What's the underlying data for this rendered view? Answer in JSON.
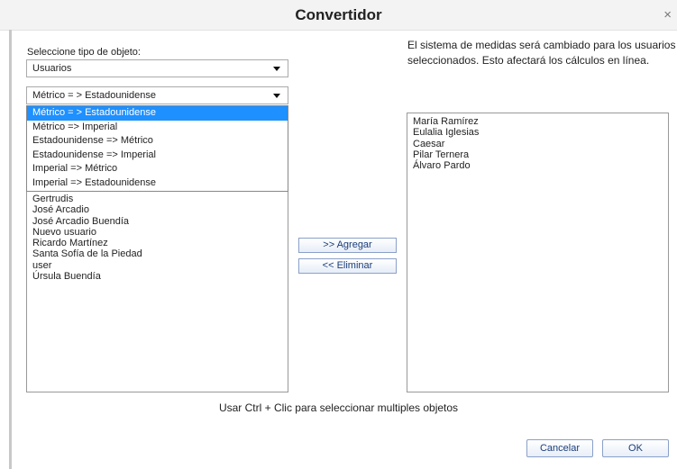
{
  "window": {
    "title": "Convertidor",
    "close_glyph": "×"
  },
  "left": {
    "object_type_label": "Seleccione tipo de objeto:",
    "object_type_value": "Usuarios",
    "conversion_value": "Métrico = > Estadounidense",
    "conversion_options": [
      "Métrico = > Estadounidense",
      "Métrico => Imperial",
      "Estadounidense => Métrico",
      "Estadounidense => Imperial",
      "Imperial => Métrico",
      "Imperial => Estadounidense"
    ],
    "conversion_selected_index": 0,
    "available_users": [
      "Gertrudis",
      "José Arcadio",
      "José Arcadio Buendía",
      "Nuevo usuario",
      "Ricardo Martínez",
      "Santa Sofía de la Piedad",
      "user",
      "Úrsula Buendía"
    ]
  },
  "middle": {
    "add_label": ">> Agregar",
    "remove_label": "<< Eliminar"
  },
  "right": {
    "info_text": "El sistema de medidas será cambiado para los usuarios seleccionados. Esto afectará los cálculos en línea.",
    "selected_users": [
      "María Ramírez",
      "Eulalia Iglesias",
      "Caesar",
      "Pilar Ternera",
      "Álvaro Pardo"
    ]
  },
  "footer": {
    "hint": "Usar Ctrl + Clic para seleccionar multiples objetos",
    "cancel_label": "Cancelar",
    "ok_label": "OK"
  },
  "colors": {
    "selection": "#1e90ff",
    "button_text": "#1a3d7a"
  }
}
